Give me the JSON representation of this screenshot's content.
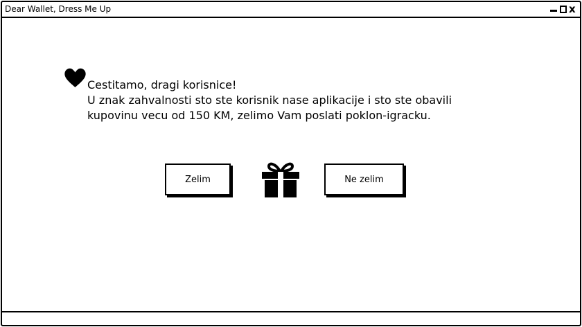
{
  "window": {
    "title": "Dear Wallet, Dress Me Up",
    "controls": {
      "minimize": "minimize-icon",
      "maximize": "maximize-icon",
      "close": "x"
    }
  },
  "message": {
    "greeting": "Cestitamo, dragi korisnice!",
    "line1": "U znak zahvalnosti sto ste korisnik nase aplikacije i sto ste obavili",
    "line2": "kupovinu vecu od 150 KM, zelimo Vam poslati poklon-igracku."
  },
  "actions": {
    "accept_label": "Zelim",
    "decline_label": "Ne zelim"
  },
  "icons": {
    "heart": "heart-icon",
    "gift": "gift-icon"
  }
}
